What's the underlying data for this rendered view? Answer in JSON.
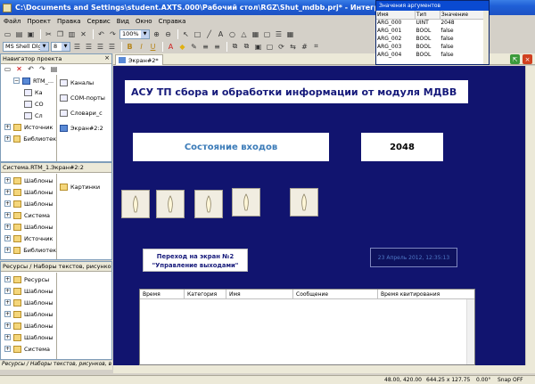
{
  "window": {
    "title": "C:\\Documents and Settings\\student.AXTS.000\\Рабочий стол\\RGZ\\Shut_mdbb.prj* - Интегрированная среда ра"
  },
  "menu": [
    "Файл",
    "Проект",
    "Правка",
    "Сервис",
    "Вид",
    "Окно",
    "Справка"
  ],
  "toolbar": {
    "zoom": "100%",
    "font": "MS Shell Dlg",
    "font_size": "8"
  },
  "project_nav": {
    "title": "Навигатор проекта",
    "left_tree": [
      {
        "label": "RTM_...",
        "icon": "folder-icon"
      },
      {
        "label": "Ка",
        "icon": "doc-icon"
      },
      {
        "label": "CO",
        "icon": "doc-icon"
      },
      {
        "label": "Сл",
        "icon": "doc-icon"
      },
      {
        "label": "Источник",
        "icon": "folder-icon"
      },
      {
        "label": "Библиотек",
        "icon": "folder-icon"
      }
    ],
    "right_items": [
      {
        "label": "Каналы"
      },
      {
        "label": "COM-порты"
      },
      {
        "label": "Словари_с"
      },
      {
        "label": "Экран#2:2"
      }
    ]
  },
  "system_panel": {
    "title": "Система.RTM_1.Экран#2:2",
    "tree": [
      "Шаблоны",
      "Шаблоны",
      "Шаблоны",
      "Система",
      "Шаблоны",
      "Источник",
      "Библиотек"
    ],
    "right_items": [
      "Картинки"
    ]
  },
  "resources_panel": {
    "title": "Ресурсы / Наборы текстов, рисунков, в",
    "tree": [
      "Ресурсы",
      "Шаблоны",
      "Шаблоны",
      "Шаблоны",
      "Шаблоны",
      "Шаблоны",
      "Система"
    ],
    "footer": "Ресурсы / Наборы текстов, рисунков, в"
  },
  "tab": {
    "label": "Экран#2*"
  },
  "screen": {
    "title": "АСУ ТП сбора и обработки информации от модуля МДВВ",
    "state_label": "Состояние входов",
    "value": "2048",
    "nav_button_line1": "Переход на экран №2",
    "nav_button_line2": "\"Управление выходами\"",
    "datetime": "23 Апрель 2012, 12:35:13",
    "lamp_count": 5,
    "alarm_columns": [
      "Время",
      "Категория",
      "Имя",
      "Сообщение",
      "Время квитирования"
    ]
  },
  "args": {
    "title": "Значения аргументов",
    "columns": [
      "Имя",
      "Тип",
      "Значение"
    ],
    "rows": [
      {
        "name": "ARG_000",
        "type": "UINT",
        "value": "2048"
      },
      {
        "name": "ARG_001",
        "type": "BOOL",
        "value": "false"
      },
      {
        "name": "ARG_002",
        "type": "BOOL",
        "value": "false"
      },
      {
        "name": "ARG_003",
        "type": "BOOL",
        "value": "false"
      },
      {
        "name": "ARG_004",
        "type": "BOOL",
        "value": "false"
      }
    ]
  },
  "status": {
    "coords": "48.00, 420.00",
    "size": "644.25 x 127.75",
    "angle": "0.00°",
    "snap": "Snap OFF"
  }
}
